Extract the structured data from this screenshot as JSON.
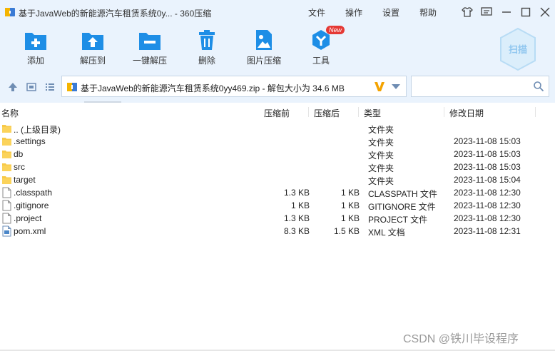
{
  "window": {
    "title": "基于JavaWeb的新能源汽车租赁系统0y... - 360压缩",
    "menu": [
      "文件",
      "操作",
      "设置",
      "帮助"
    ],
    "controls": [
      "shirt-icon",
      "feedback-icon",
      "minimize-icon",
      "maximize-icon",
      "close-icon"
    ]
  },
  "toolbar": {
    "items": [
      {
        "label": "添加",
        "icon": "add-archive-icon"
      },
      {
        "label": "解压到",
        "icon": "extract-to-icon"
      },
      {
        "label": "一键解压",
        "icon": "one-click-extract-icon"
      },
      {
        "label": "删除",
        "icon": "delete-icon"
      },
      {
        "label": "图片压缩",
        "icon": "image-compress-icon"
      },
      {
        "label": "工具",
        "icon": "tools-icon",
        "badge": "New"
      }
    ],
    "scan_label": "扫描"
  },
  "addressbar": {
    "path_text": "基于JavaWeb的新能源汽车租赁系统0yy469.zip - 解包大小为 34.6 MB",
    "search_placeholder": ""
  },
  "columns": {
    "name": "名称",
    "before": "压缩前",
    "after": "压缩后",
    "type": "类型",
    "date": "修改日期"
  },
  "files": [
    {
      "name": ".. (上级目录)",
      "before": "",
      "after": "",
      "type": "文件夹",
      "date": "",
      "icon": "folder-icon"
    },
    {
      "name": ".settings",
      "before": "",
      "after": "",
      "type": "文件夹",
      "date": "2023-11-08 15:03",
      "icon": "folder-icon"
    },
    {
      "name": "db",
      "before": "",
      "after": "",
      "type": "文件夹",
      "date": "2023-11-08 15:03",
      "icon": "folder-icon"
    },
    {
      "name": "src",
      "before": "",
      "after": "",
      "type": "文件夹",
      "date": "2023-11-08 15:03",
      "icon": "folder-icon"
    },
    {
      "name": "target",
      "before": "",
      "after": "",
      "type": "文件夹",
      "date": "2023-11-08 15:04",
      "icon": "folder-icon"
    },
    {
      "name": ".classpath",
      "before": "1.3 KB",
      "after": "1 KB",
      "type": "CLASSPATH 文件",
      "date": "2023-11-08 12:30",
      "icon": "file-icon"
    },
    {
      "name": ".gitignore",
      "before": "1 KB",
      "after": "1 KB",
      "type": "GITIGNORE 文件",
      "date": "2023-11-08 12:30",
      "icon": "file-icon"
    },
    {
      "name": ".project",
      "before": "1.3 KB",
      "after": "1 KB",
      "type": "PROJECT 文件",
      "date": "2023-11-08 12:30",
      "icon": "file-icon"
    },
    {
      "name": "pom.xml",
      "before": "8.3 KB",
      "after": "1.5 KB",
      "type": "XML 文档",
      "date": "2023-11-08 12:31",
      "icon": "xml-file-icon"
    }
  ],
  "watermark": "CSDN @铁川毕设程序",
  "colors": {
    "chrome_bg": "#eaf3fd",
    "icon_blue": "#1e8ee6",
    "folder": "#f7c948",
    "badge": "#e53935"
  }
}
